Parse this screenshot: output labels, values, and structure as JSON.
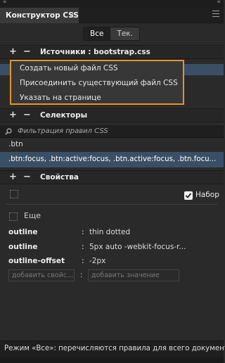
{
  "panel": {
    "title": "Конструктор CSS",
    "close_glyph": "×",
    "collapse_left": "«",
    "collapse_right": "«"
  },
  "view_toggle": {
    "all": "Все",
    "current": "Тек."
  },
  "sources": {
    "label": "Источники : bootstrap.css",
    "add": "+",
    "remove": "−"
  },
  "source_menu": {
    "items": [
      "Создать новый файл CSS",
      "Присоединить существующий файл CSS",
      "Указать на странице"
    ]
  },
  "selectors": {
    "label": "Селекторы",
    "add": "+",
    "remove": "−",
    "filter_placeholder": "Фильтрация правил CSS",
    "items": [
      ".btn",
      ".btn:focus, .btn:active:focus, .btn.active:focus, .btn.focu..."
    ]
  },
  "properties": {
    "label": "Свойства",
    "add": "+",
    "remove": "−",
    "set_checkbox_label": "Набор",
    "set_checked": true,
    "more_label": "Еще",
    "rows": [
      {
        "name": "outline",
        "value": "thin dotted"
      },
      {
        "name": "outline",
        "value": "5px auto -webkit-focus-r..."
      },
      {
        "name": "outline-offset",
        "value": "-2px"
      }
    ],
    "add_property_placeholder": "добавить свойс...",
    "add_value_placeholder": "добавить значение"
  },
  "footer": {
    "text": "Режим «Все»: перечисляются правила для всего документа"
  },
  "colors": {
    "accent_highlight": "#e1952c",
    "selection_blue": "#3a4f66"
  }
}
